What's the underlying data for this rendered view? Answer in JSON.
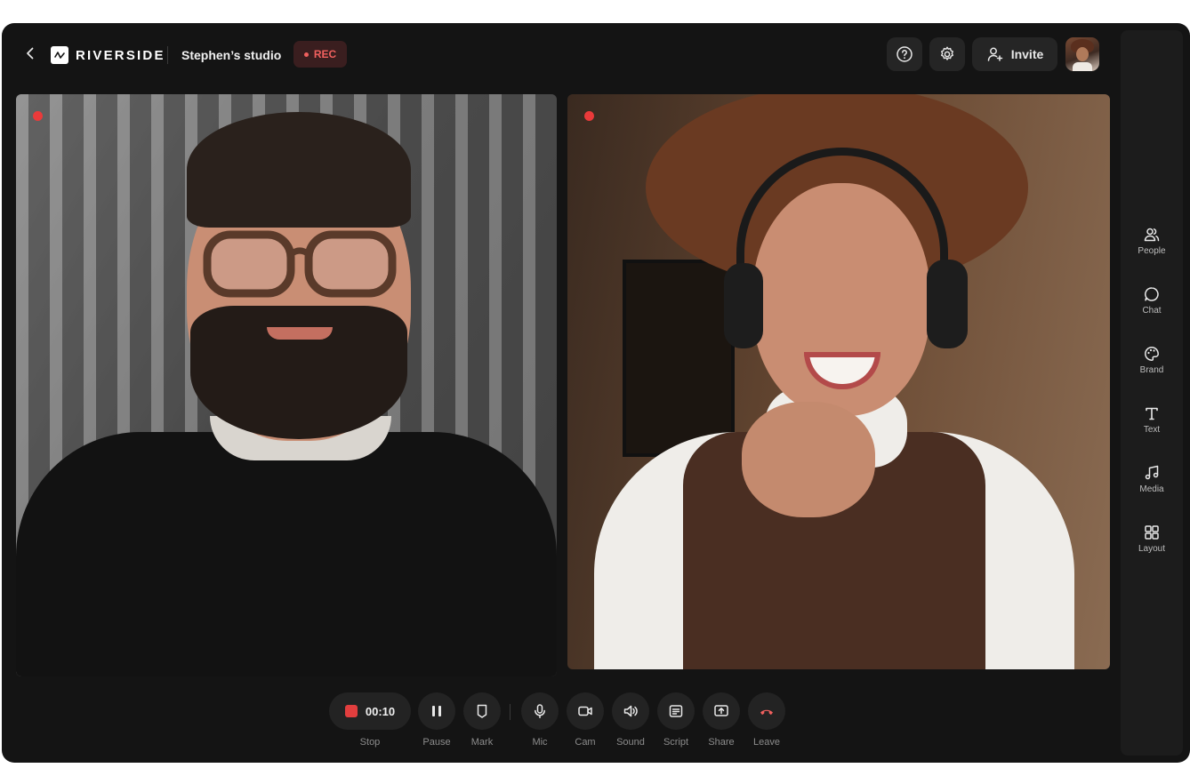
{
  "header": {
    "brand": "RIVERSIDE",
    "studio_name": "Stephen’s studio",
    "rec_badge": "REC",
    "invite_label": "Invite"
  },
  "toolbar": {
    "timer": "00:10",
    "stop_label": "Stop",
    "pause_label": "Pause",
    "mark_label": "Mark",
    "mic_label": "Mic",
    "cam_label": "Cam",
    "sound_label": "Sound",
    "script_label": "Script",
    "share_label": "Share",
    "leave_label": "Leave"
  },
  "sidebar": {
    "items": [
      {
        "label": "People",
        "icon": "people-icon"
      },
      {
        "label": "Chat",
        "icon": "chat-icon"
      },
      {
        "label": "Brand",
        "icon": "palette-icon"
      },
      {
        "label": "Text",
        "icon": "text-icon"
      },
      {
        "label": "Media",
        "icon": "music-note-icon"
      },
      {
        "label": "Layout",
        "icon": "grid-icon"
      }
    ]
  },
  "colors": {
    "background": "#141414",
    "surface": "#232323",
    "recording_red": "#e23e3e",
    "rec_badge_bg": "#3a1e1f",
    "leave_red": "#f0605e"
  }
}
